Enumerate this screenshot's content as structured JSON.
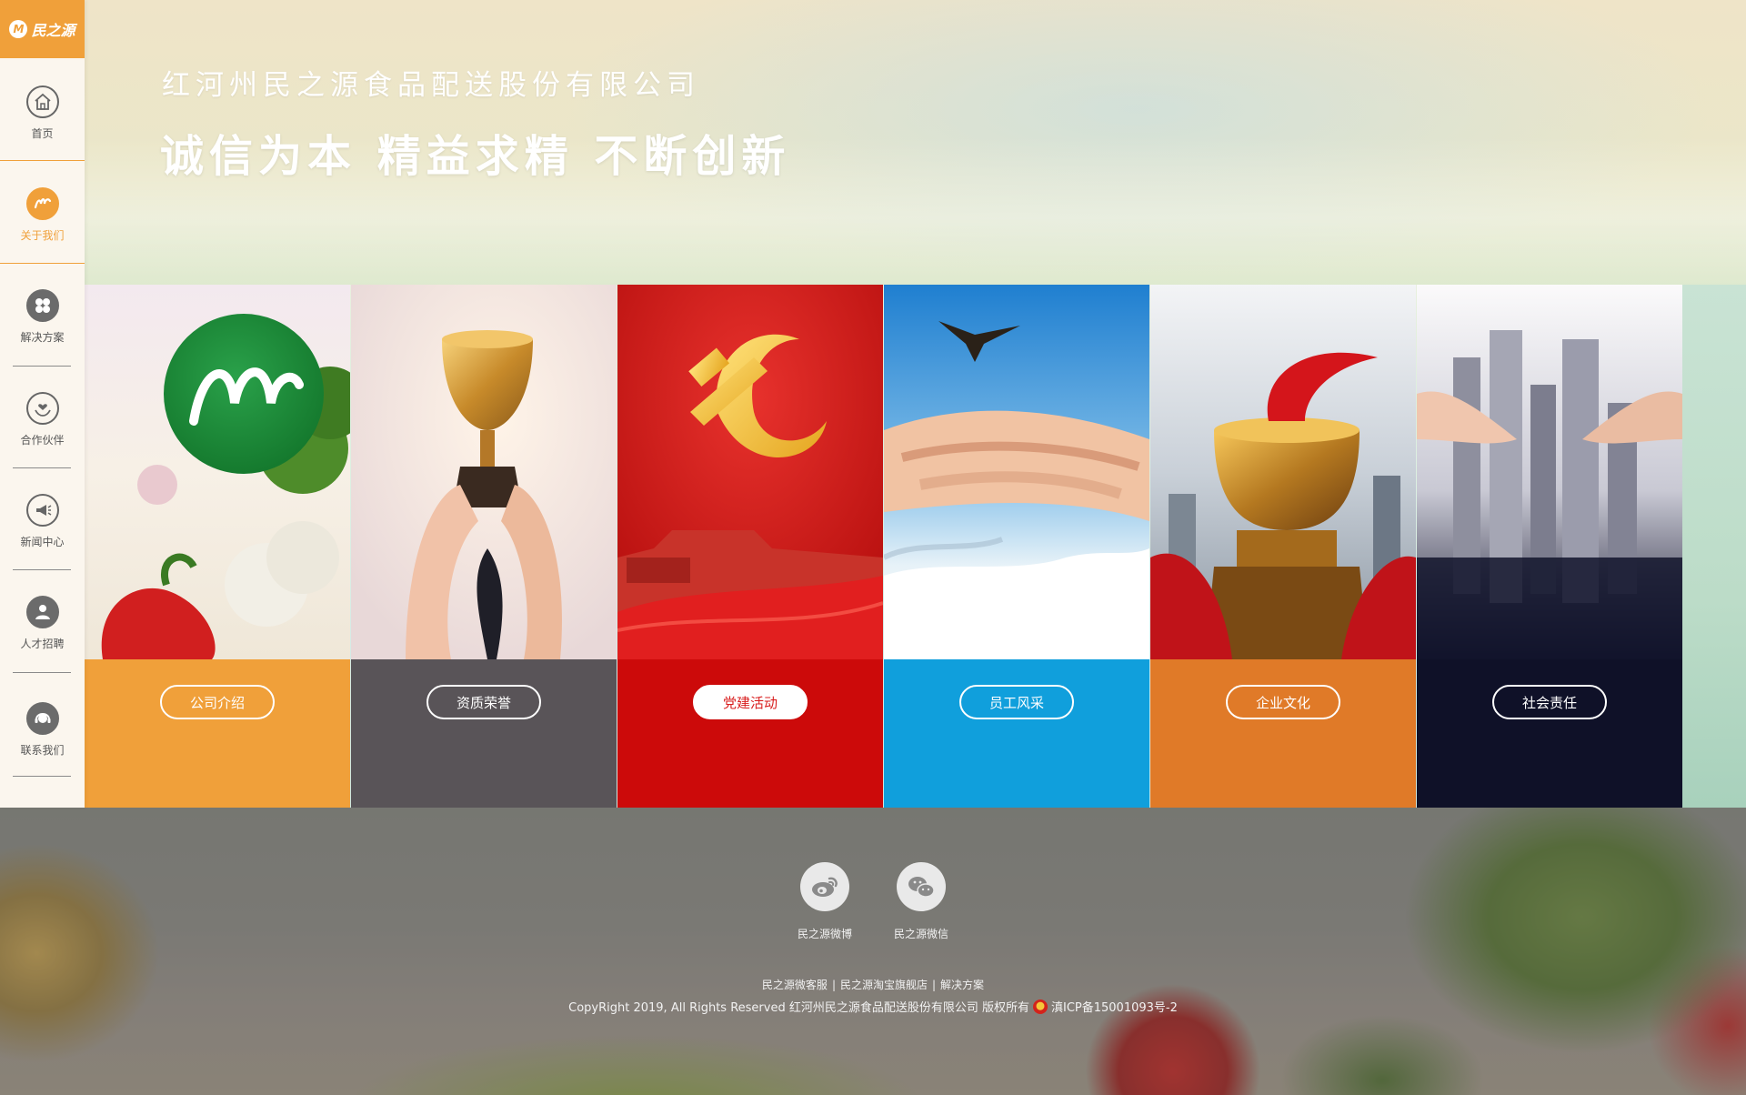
{
  "logo": {
    "mark": "M",
    "text": "民之源"
  },
  "sidebar": {
    "items": [
      {
        "label": "首页",
        "icon": "home-icon"
      },
      {
        "label": "关于我们",
        "icon": "brand-m-icon",
        "active": true
      },
      {
        "label": "解决方案",
        "icon": "clover-icon"
      },
      {
        "label": "合作伙伴",
        "icon": "handshake-heart-icon"
      },
      {
        "label": "新闻中心",
        "icon": "megaphone-icon"
      },
      {
        "label": "人才招聘",
        "icon": "person-icon"
      },
      {
        "label": "联系我们",
        "icon": "headset-icon"
      }
    ]
  },
  "hero": {
    "company_name": "红河州民之源食品配送股份有限公司",
    "motto": "诚信为本 精益求精 不断创新"
  },
  "cards": [
    {
      "label": "公司介绍",
      "color": "#f0a03a"
    },
    {
      "label": "资质荣誉",
      "color": "#595458"
    },
    {
      "label": "党建活动",
      "color": "#cc0a0a",
      "active": true
    },
    {
      "label": "员工风采",
      "color": "#109fdc"
    },
    {
      "label": "企业文化",
      "color": "#e07a28"
    },
    {
      "label": "社会责任",
      "color": "#0f1128"
    }
  ],
  "footer": {
    "social": [
      {
        "label": "民之源微博",
        "icon": "weibo-icon"
      },
      {
        "label": "民之源微信",
        "icon": "wechat-icon"
      }
    ],
    "links": [
      "民之源微客服",
      "民之源淘宝旗舰店",
      "解决方案"
    ],
    "link_separator": "|",
    "copyright": "CopyRight 2019, All Rights Reserved 红河州民之源食品配送股份有限公司 版权所有",
    "icp": "滇ICP备15001093号-2"
  }
}
